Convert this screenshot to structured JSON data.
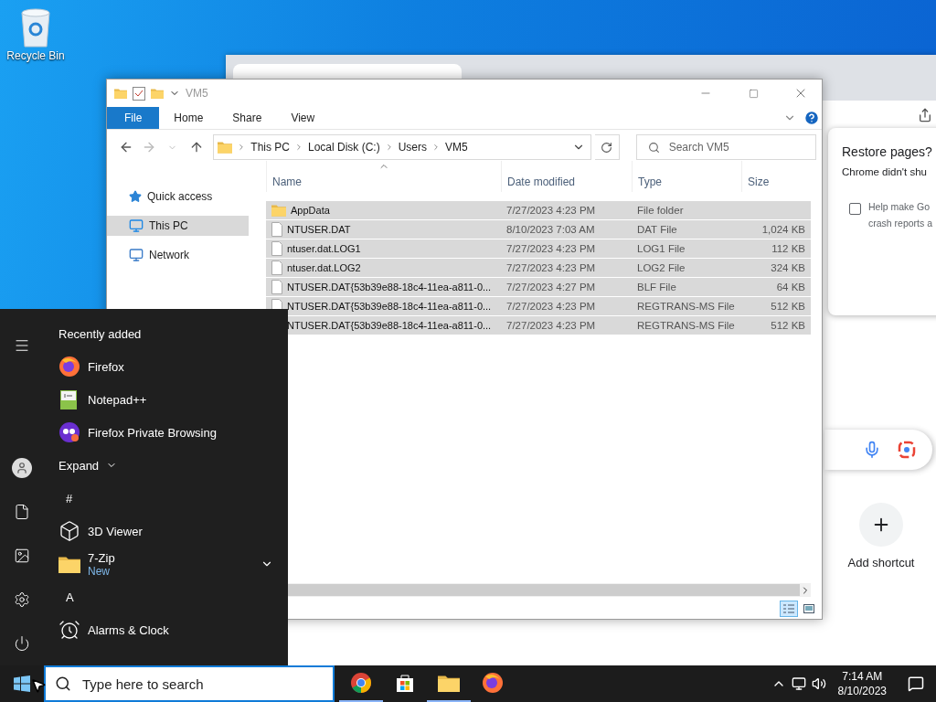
{
  "desktop": {
    "icons": [
      {
        "label": "Recycle Bin",
        "kind": "recycle_bin"
      }
    ]
  },
  "browser": {
    "restore_dialog": {
      "title": "Restore pages?",
      "message": "Chrome didn't shu",
      "checkbox": {
        "checked": false,
        "lines": [
          "Help make Go",
          "crash reports a"
        ]
      }
    },
    "shortcut": {
      "label": "Add shortcut"
    }
  },
  "explorer": {
    "title": "VM5",
    "file_menu": {
      "label": "File"
    },
    "ribbon_tabs": [
      {
        "label": "Home"
      },
      {
        "label": "Share"
      },
      {
        "label": "View"
      }
    ],
    "breadcrumbs": [
      "This PC",
      "Local Disk (C:)",
      "Users",
      "VM5"
    ],
    "search": {
      "placeholder": "Search VM5"
    },
    "nav_pane": [
      {
        "label": "Quick access",
        "kind": "quick_access",
        "selected": false
      },
      {
        "label": "This PC",
        "kind": "pc",
        "selected": true
      },
      {
        "label": "Network",
        "kind": "network",
        "selected": false
      }
    ],
    "columns": [
      {
        "label": "Name",
        "sorted": true
      },
      {
        "label": "Date modified",
        "sorted": false
      },
      {
        "label": "Type",
        "sorted": false
      },
      {
        "label": "Size",
        "sorted": false
      }
    ],
    "rows": [
      {
        "kind": "folder",
        "name": "AppData",
        "date": "7/27/2023 4:23 PM",
        "type": "File folder",
        "selected": true
      },
      {
        "kind": "file",
        "name": "NTUSER.DAT",
        "date": "8/10/2023 7:03 AM",
        "type": "DAT File",
        "size": "1,024 KB",
        "selected": true
      },
      {
        "kind": "file",
        "name": "ntuser.dat.LOG1",
        "date": "7/27/2023 4:23 PM",
        "type": "LOG1 File",
        "size": "112 KB",
        "selected": true
      },
      {
        "kind": "file",
        "name": "ntuser.dat.LOG2",
        "date": "7/27/2023 4:23 PM",
        "type": "LOG2 File",
        "size": "324 KB",
        "selected": true
      },
      {
        "kind": "file",
        "name": "NTUSER.DAT{53b39e88-18c4-11ea-a811-0...",
        "date": "7/27/2023 4:27 PM",
        "type": "BLF File",
        "size": "64 KB",
        "selected": true
      },
      {
        "kind": "file",
        "name": "NTUSER.DAT{53b39e88-18c4-11ea-a811-0...",
        "date": "7/27/2023 4:23 PM",
        "type": "REGTRANS-MS File",
        "size": "512 KB",
        "selected": true
      },
      {
        "kind": "file",
        "name": "NTUSER.DAT{53b39e88-18c4-11ea-a811-0...",
        "date": "7/27/2023 4:23 PM",
        "type": "REGTRANS-MS File",
        "size": "512 KB",
        "selected": true
      }
    ],
    "view_buttons": [
      {
        "kind": "details",
        "selected": true
      },
      {
        "kind": "large_icons",
        "selected": false
      }
    ]
  },
  "start_menu": {
    "items": [
      {
        "kind": "header",
        "label": "Recently added"
      },
      {
        "kind": "firefox",
        "label": "Firefox",
        "expandable": false
      },
      {
        "kind": "notepad",
        "label": "Notepad++",
        "expandable": false
      },
      {
        "kind": "firefox_private",
        "label": "Firefox Private Browsing",
        "expandable": false
      },
      {
        "kind": "expand",
        "label": "Expand"
      },
      {
        "kind": "letter",
        "label": "#"
      },
      {
        "kind": "cube",
        "label": "3D Viewer",
        "expandable": false
      },
      {
        "kind": "folder",
        "label": "7-Zip",
        "badge": "New",
        "expandable": true
      },
      {
        "kind": "letter",
        "label": "A"
      },
      {
        "kind": "clock",
        "label": "Alarms & Clock",
        "expandable": false
      }
    ]
  },
  "taskbar": {
    "search": {
      "placeholder": "Type here to search"
    },
    "apps": [
      {
        "kind": "chrome",
        "running": true
      },
      {
        "kind": "store",
        "running": false
      },
      {
        "kind": "explorer",
        "running": true
      },
      {
        "kind": "firefox",
        "running": false
      }
    ],
    "clock": {
      "time": "7:14 AM",
      "date": "8/10/2023"
    }
  }
}
